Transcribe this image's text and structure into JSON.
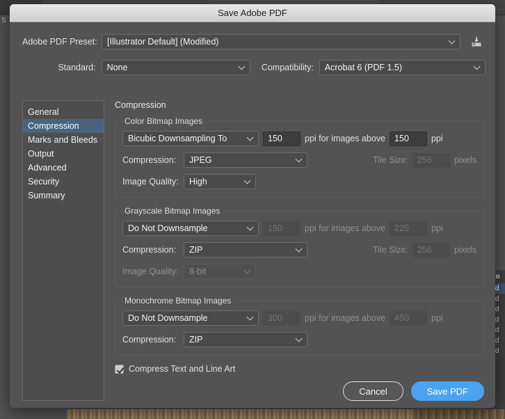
{
  "background": {
    "left_edge_label": "S",
    "artboards_panel": {
      "title": "tbo",
      "rows": [
        "ard",
        "ard",
        "ard",
        "ard",
        "ard",
        "ard",
        "ard"
      ],
      "selected_index": 0
    }
  },
  "dialog": {
    "title": "Save Adobe PDF",
    "preset_row": {
      "label": "Adobe PDF Preset:",
      "value": "[Illustrator Default] (Modified)",
      "save_icon": "save-preset-icon"
    },
    "standard_row": {
      "standard_label": "Standard:",
      "standard_value": "None",
      "compatibility_label": "Compatibility:",
      "compatibility_value": "Acrobat 6 (PDF 1.5)"
    },
    "sidebar": {
      "items": [
        {
          "label": "General",
          "active": false
        },
        {
          "label": "Compression",
          "active": true
        },
        {
          "label": "Marks and Bleeds",
          "active": false
        },
        {
          "label": "Output",
          "active": false
        },
        {
          "label": "Advanced",
          "active": false
        },
        {
          "label": "Security",
          "active": false
        },
        {
          "label": "Summary",
          "active": false
        }
      ]
    },
    "panel": {
      "title": "Compression",
      "groups": [
        {
          "legend": "Color Bitmap Images",
          "resample_value": "Bicubic Downsampling To",
          "resample_disabled": false,
          "ppi_value": "150",
          "ppi_disabled": false,
          "above_text": "ppi for images above",
          "above_value": "150",
          "above_disabled": false,
          "ppi_unit": "ppi",
          "compression_label": "Compression:",
          "compression_value": "JPEG",
          "compression_disabled": false,
          "tile_label": "Tile Size:",
          "tile_value": "256",
          "tile_unit": "pixels",
          "tile_disabled": true,
          "quality_label": "Image Quality:",
          "quality_value": "High",
          "quality_disabled": false,
          "has_quality": true
        },
        {
          "legend": "Grayscale Bitmap Images",
          "resample_value": "Do Not Downsample",
          "resample_disabled": false,
          "ppi_value": "150",
          "ppi_disabled": true,
          "above_text": "ppi for images above",
          "above_value": "225",
          "above_disabled": true,
          "ppi_unit": "ppi",
          "compression_label": "Compression:",
          "compression_value": "ZIP",
          "compression_disabled": false,
          "tile_label": "Tile Size:",
          "tile_value": "256",
          "tile_unit": "pixels",
          "tile_disabled": true,
          "quality_label": "Image Quality:",
          "quality_value": "8-bit",
          "quality_disabled": true,
          "has_quality": true
        },
        {
          "legend": "Monochrome Bitmap Images",
          "resample_value": "Do Not Downsample",
          "resample_disabled": false,
          "ppi_value": "300",
          "ppi_disabled": true,
          "above_text": "ppi for images above",
          "above_value": "450",
          "above_disabled": true,
          "ppi_unit": "ppi",
          "compression_label": "Compression:",
          "compression_value": "ZIP",
          "compression_disabled": false,
          "tile_label": "",
          "tile_value": "",
          "tile_unit": "",
          "tile_disabled": true,
          "quality_label": "",
          "quality_value": "",
          "quality_disabled": true,
          "has_quality": false
        }
      ],
      "compress_text_checkbox": {
        "label": "Compress Text and Line Art",
        "checked": true
      }
    },
    "footer": {
      "cancel_label": "Cancel",
      "save_label": "Save PDF"
    }
  },
  "colors": {
    "dialog_background": "#535353",
    "titlebar": "#dcdcdc",
    "accent_selection": "#4a6480",
    "primary_button": "#4ba3ef",
    "field_background": "#4a4a4a",
    "numeric_field": "#3d3d3d"
  }
}
